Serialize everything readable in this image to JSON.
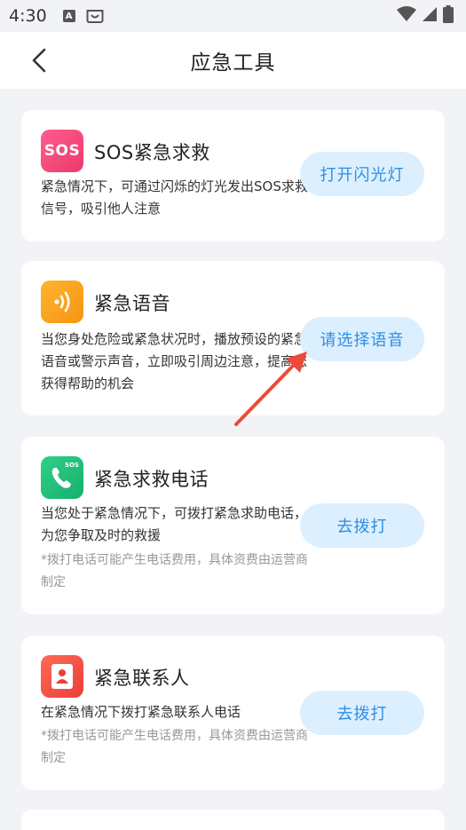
{
  "status_bar": {
    "time": "4:30",
    "a_icon": "A"
  },
  "header": {
    "title": "应急工具"
  },
  "cards": [
    {
      "title": "SOS紧急求救",
      "icon_label": "SOS",
      "desc": "紧急情况下，可通过闪烁的灯光发出SOS求救信号，吸引他人注意",
      "button": "打开闪光灯"
    },
    {
      "title": "紧急语音",
      "desc": "当您身处危险或紧急状况时，播放预设的紧急语音或警示声音，立即吸引周边注意，提高您获得帮助的机会",
      "button": "请选择语音"
    },
    {
      "title": "紧急求救电话",
      "icon_label": "SOS",
      "desc": "当您处于紧急情况下，可拨打紧急求助电话，为您争取及时的救援",
      "note": "*拨打电话可能产生电话费用，具体资费由运营商制定",
      "button": "去拨打"
    },
    {
      "title": "紧急联系人",
      "desc": "在紧急情况下拨打紧急联系人电话",
      "note": "*拨打电话可能产生电话费用，具体资费由运营商制定",
      "button": "去拨打"
    }
  ],
  "colors": {
    "sos_icon": "#f2457a",
    "voice_icon": "#f6a21a",
    "phone_icon": "#1fbf7a",
    "contact_icon": "#f2504a",
    "button_bg": "#dcefff",
    "button_text": "#2f8fe0",
    "annotation_arrow": "#ec4a3c"
  }
}
